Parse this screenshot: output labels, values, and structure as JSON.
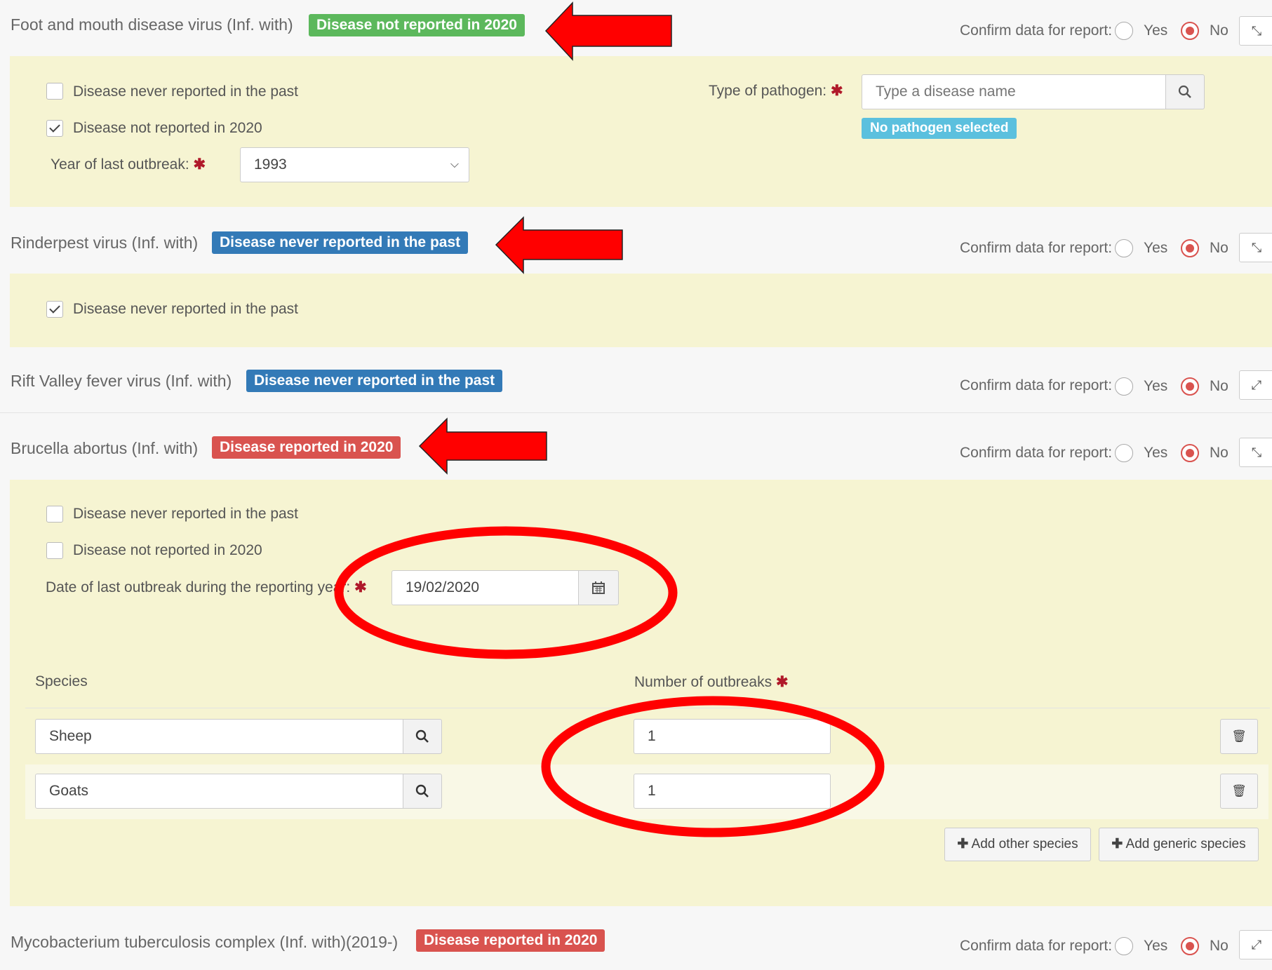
{
  "confirm": {
    "label": "Confirm data for report:",
    "yes": "Yes",
    "no": "No"
  },
  "fmd": {
    "title": "Foot and mouth disease virus (Inf. with)",
    "badge": "Disease not reported in 2020",
    "never_reported": "Disease never reported in the past",
    "not_reported": "Disease not reported in 2020",
    "year_label": "Year of last outbreak:",
    "year_value": "1993",
    "pathogen_label": "Type of pathogen:",
    "pathogen_placeholder": "Type a disease name",
    "pathogen_badge": "No pathogen selected"
  },
  "rinderpest": {
    "title": "Rinderpest virus (Inf. with)",
    "badge": "Disease never reported in the past",
    "never_reported": "Disease never reported in the past"
  },
  "rvf": {
    "title": "Rift Valley fever virus (Inf. with)",
    "badge": "Disease never reported in the past"
  },
  "brucella": {
    "title": "Brucella abortus (Inf. with)",
    "badge": "Disease reported in 2020",
    "never_reported": "Disease never reported in the past",
    "not_reported": "Disease not reported in 2020",
    "date_label": "Date of last outbreak during the reporting year:",
    "date_value": "19/02/2020",
    "species_header": "Species",
    "outbreaks_header": "Number of outbreaks",
    "species": [
      {
        "name": "Sheep",
        "outbreaks": "1"
      },
      {
        "name": "Goats",
        "outbreaks": "1"
      }
    ],
    "add_other": "Add other species",
    "add_generic": "Add generic species"
  },
  "myco": {
    "title": "Mycobacterium tuberculosis complex (Inf. with)(2019-)",
    "badge": "Disease reported in 2020"
  },
  "colors": {
    "green_badge": "#5cb85c",
    "blue_badge": "#337ab7",
    "red_badge": "#d9534f",
    "cyan_badge": "#5bc0de",
    "panel": "#f6f4d2",
    "annotation": "#ff0000"
  }
}
